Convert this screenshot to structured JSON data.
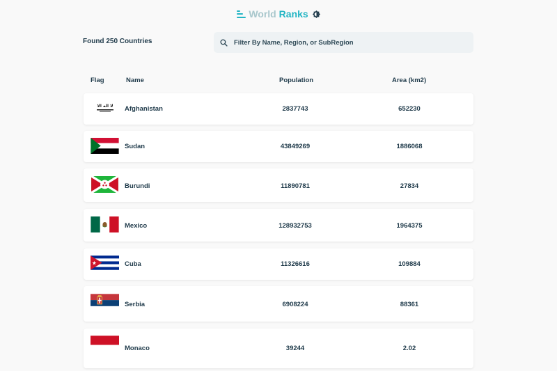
{
  "header": {
    "title_part1": "World",
    "title_part2": "Ranks",
    "logo_icon": "bar-chart-icon",
    "theme_icon": "theme-toggle-icon"
  },
  "summary": {
    "found_label": "Found 250 Countries"
  },
  "search": {
    "placeholder": "Filter By Name, Region, or SubRegion",
    "icon": "search-icon"
  },
  "table": {
    "columns": {
      "flag": "Flag",
      "name": "Name",
      "population": "Population",
      "area": "Area (km2)"
    },
    "rows": [
      {
        "flag": "afghanistan-flag",
        "name": "Afghanistan",
        "population": "2837743",
        "area": "652230"
      },
      {
        "flag": "sudan-flag",
        "name": "Sudan",
        "population": "43849269",
        "area": "1886068"
      },
      {
        "flag": "burundi-flag",
        "name": "Burundi",
        "population": "11890781",
        "area": "27834"
      },
      {
        "flag": "mexico-flag",
        "name": "Mexico",
        "population": "128932753",
        "area": "1964375"
      },
      {
        "flag": "cuba-flag",
        "name": "Cuba",
        "population": "11326616",
        "area": "109884"
      },
      {
        "flag": "serbia-flag",
        "name": "Serbia",
        "population": "6908224",
        "area": "88361"
      },
      {
        "flag": "monaco-flag",
        "name": "Monaco",
        "population": "39244",
        "area": "2.02"
      }
    ]
  },
  "colors": {
    "accent": "#23b5c4",
    "accent_light": "#a9c7cc",
    "text": "#1f3a4a",
    "search_bg": "#eef2f4"
  }
}
